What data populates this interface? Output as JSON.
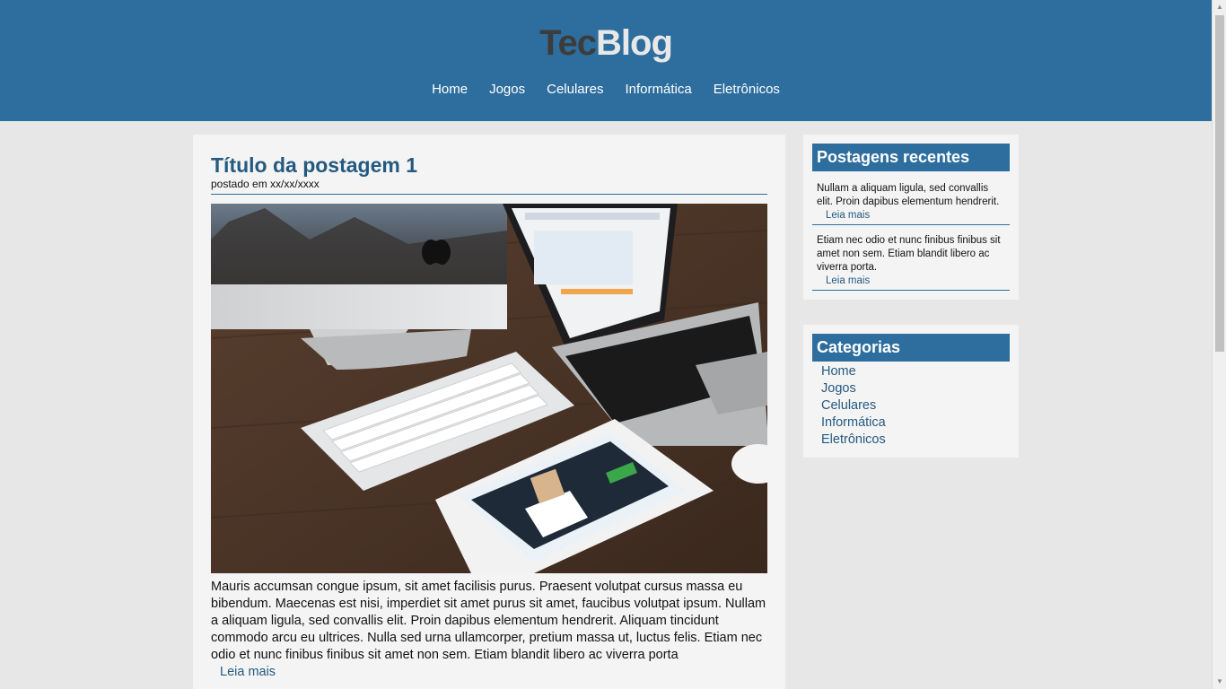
{
  "header": {
    "logo_part1": "Tec",
    "logo_part2": "Blog",
    "nav": [
      {
        "label": "Home"
      },
      {
        "label": "Jogos"
      },
      {
        "label": "Celulares"
      },
      {
        "label": "Informática"
      },
      {
        "label": "Eletrônicos"
      }
    ]
  },
  "post": {
    "title": "Título da postagem 1",
    "date": "postado em xx/xx/xxxx",
    "image_icon": "desk-workspace-photo",
    "body": "Mauris accumsan congue ipsum, sit amet facilisis purus. Praesent volutpat cursus massa eu bibendum. Maecenas est nisi, imperdiet sit amet purus sit amet, faucibus volutpat ipsum. Nullam a aliquam ligula, sed convallis elit. Proin dapibus elementum hendrerit. Aliquam tincidunt commodo arcu eu ultrices. Nulla sed urna ullamcorper, pretium massa ut, luctus felis. Etiam nec odio et nunc finibus finibus sit amet non sem. Etiam blandit libero ac viverra porta",
    "read_more": "Leia mais"
  },
  "sidebar": {
    "recent": {
      "title": "Postagens recentes",
      "items": [
        {
          "text": "Nullam a aliquam ligula, sed convallis elit. Proin dapibus elementum hendrerit.",
          "read_more": "Leia mais"
        },
        {
          "text": "Etiam nec odio et nunc finibus finibus sit amet non sem. Etiam blandit libero ac viverra porta.",
          "read_more": "Leia mais"
        }
      ]
    },
    "categories": {
      "title": "Categorias",
      "items": [
        {
          "label": "Home"
        },
        {
          "label": "Jogos"
        },
        {
          "label": "Celulares"
        },
        {
          "label": "Informática"
        },
        {
          "label": "Eletrônicos"
        }
      ]
    }
  },
  "colors": {
    "header_bg": "#2e6e9e",
    "link": "#245a80",
    "page_bg": "#e7e7e7",
    "card_bg": "#f4f4f4"
  }
}
